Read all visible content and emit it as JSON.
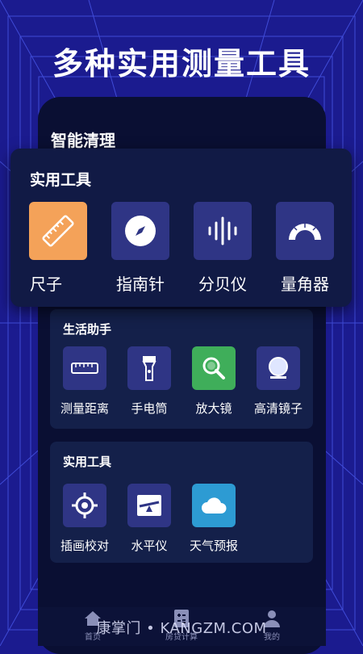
{
  "headline": "多种实用测量工具",
  "app": {
    "section_title": "智能清理"
  },
  "popup": {
    "title": "实用工具",
    "tools": [
      {
        "label": "尺子",
        "icon": "ruler-icon",
        "color": "#f4a259"
      },
      {
        "label": "指南针",
        "icon": "compass-icon",
        "color": "#2f3585"
      },
      {
        "label": "分贝仪",
        "icon": "sound-wave-icon",
        "color": "#2f3585"
      },
      {
        "label": "量角器",
        "icon": "protractor-icon",
        "color": "#2f3585"
      }
    ]
  },
  "life_helper": {
    "title": "生活助手",
    "tools": [
      {
        "label": "测量距离",
        "icon": "tape-measure-icon"
      },
      {
        "label": "手电筒",
        "icon": "flashlight-icon"
      },
      {
        "label": "放大镜",
        "icon": "magnifier-icon",
        "color": "#3fae5a"
      },
      {
        "label": "高清镜子",
        "icon": "mirror-icon"
      }
    ]
  },
  "utility": {
    "title": "实用工具",
    "tools": [
      {
        "label": "插画校对",
        "icon": "crosshair-icon"
      },
      {
        "label": "水平仪",
        "icon": "level-icon"
      },
      {
        "label": "天气预报",
        "icon": "weather-cloud-icon",
        "color": "#2d9bd3"
      }
    ]
  },
  "tabbar": {
    "items": [
      {
        "label": "首页",
        "icon": "home-icon"
      },
      {
        "label": "房贷计算",
        "icon": "calculator-icon"
      },
      {
        "label": "我的",
        "icon": "user-icon"
      }
    ]
  },
  "watermark": "康掌门 • KANGZM.COM",
  "colors": {
    "background": "#1b1b8f",
    "panel": "#0a0f33",
    "card": "#14204a",
    "icon_tile": "#2f3585",
    "accent_orange": "#f4a259"
  }
}
